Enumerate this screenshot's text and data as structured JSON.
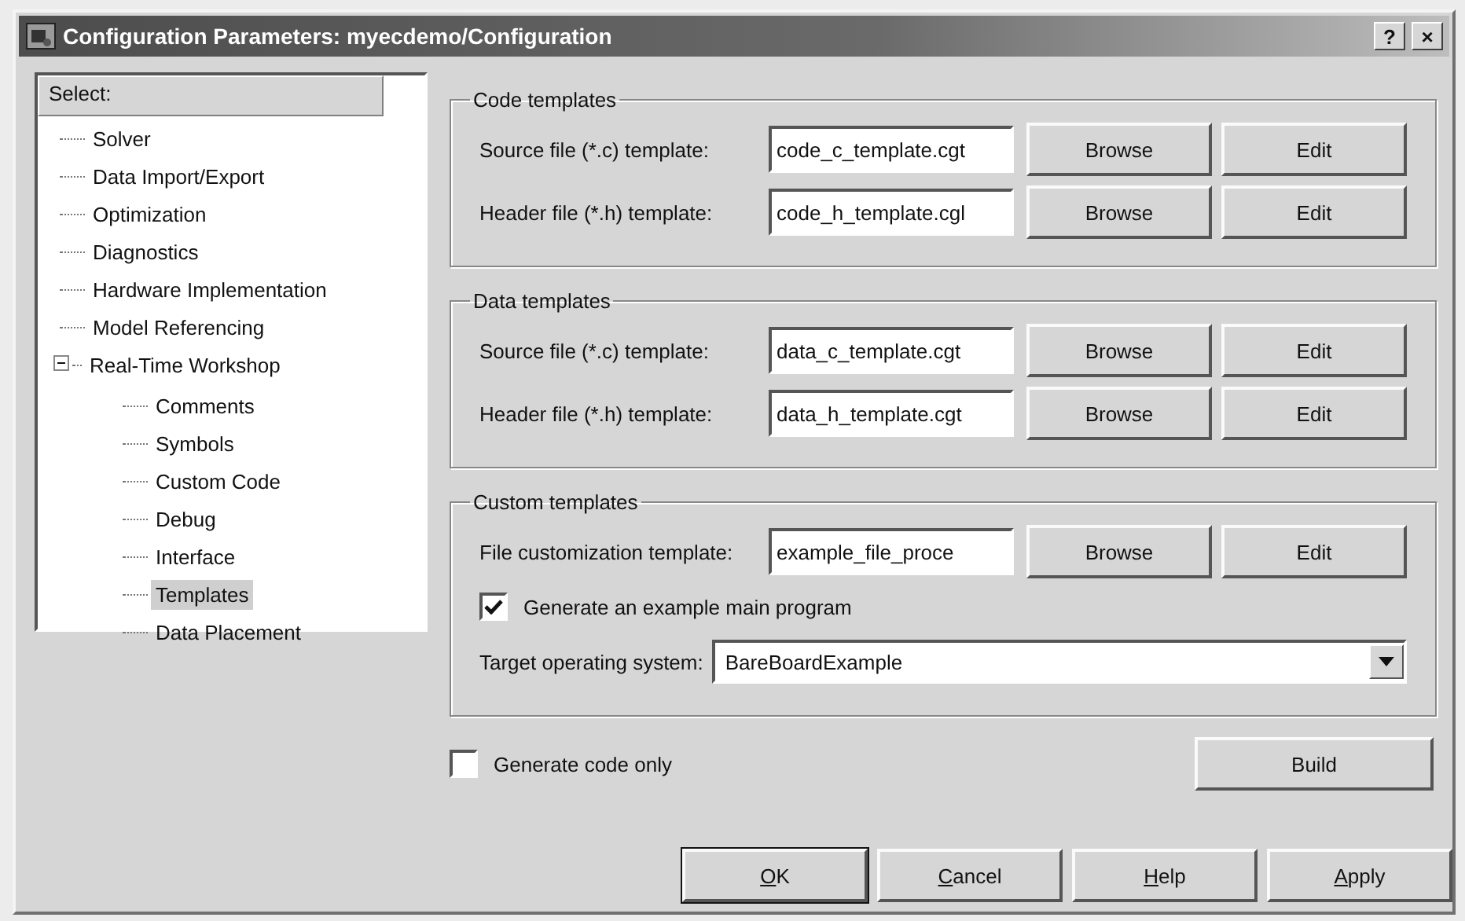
{
  "window": {
    "title": "Configuration Parameters: myecdemo/Configuration",
    "help_button": "?",
    "close_button": "×"
  },
  "tree": {
    "header": "Select:",
    "items": [
      {
        "label": "Solver",
        "selected": false
      },
      {
        "label": "Data Import/Export",
        "selected": false
      },
      {
        "label": "Optimization",
        "selected": false
      },
      {
        "label": "Diagnostics",
        "selected": false
      },
      {
        "label": "Hardware Implementation",
        "selected": false
      },
      {
        "label": "Model Referencing",
        "selected": false
      },
      {
        "label": "Real-Time Workshop",
        "selected": false,
        "expanded": true,
        "children": [
          {
            "label": "Comments",
            "selected": false
          },
          {
            "label": "Symbols",
            "selected": false
          },
          {
            "label": "Custom Code",
            "selected": false
          },
          {
            "label": "Debug",
            "selected": false
          },
          {
            "label": "Interface",
            "selected": false
          },
          {
            "label": "Templates",
            "selected": true
          },
          {
            "label": "Data Placement",
            "selected": false
          }
        ]
      }
    ]
  },
  "groups": [
    {
      "title": "Code templates",
      "rows": [
        {
          "kind": "file",
          "label": "Source file (*.c) template:",
          "value": "code_c_template.cgt",
          "browse": "Browse",
          "edit": "Edit"
        },
        {
          "kind": "file",
          "label": "Header file (*.h) template:",
          "value": "code_h_template.cgl",
          "browse": "Browse",
          "edit": "Edit"
        }
      ]
    },
    {
      "title": "Data templates",
      "rows": [
        {
          "kind": "file",
          "label": "Source file (*.c) template:",
          "value": "data_c_template.cgt",
          "browse": "Browse",
          "edit": "Edit"
        },
        {
          "kind": "file",
          "label": "Header file (*.h) template:",
          "value": "data_h_template.cgt",
          "browse": "Browse",
          "edit": "Edit"
        }
      ]
    },
    {
      "title": "Custom templates",
      "rows": [
        {
          "kind": "file",
          "label": "File customization template:",
          "value": "example_file_proce",
          "browse": "Browse",
          "edit": "Edit"
        },
        {
          "kind": "checkbox",
          "label": "Generate an example main program",
          "checked": true
        },
        {
          "kind": "select",
          "label": "Target operating system:",
          "value": "BareBoardExample"
        }
      ]
    }
  ],
  "generate_code_only": {
    "label": "Generate code only",
    "checked": false
  },
  "build_button": "Build",
  "buttons": [
    {
      "key": "O",
      "rest": "K",
      "default": true
    },
    {
      "key": "C",
      "rest": "ancel",
      "default": false
    },
    {
      "key": "H",
      "rest": "elp",
      "default": false
    },
    {
      "key": "A",
      "rest": "pply",
      "default": false
    }
  ]
}
